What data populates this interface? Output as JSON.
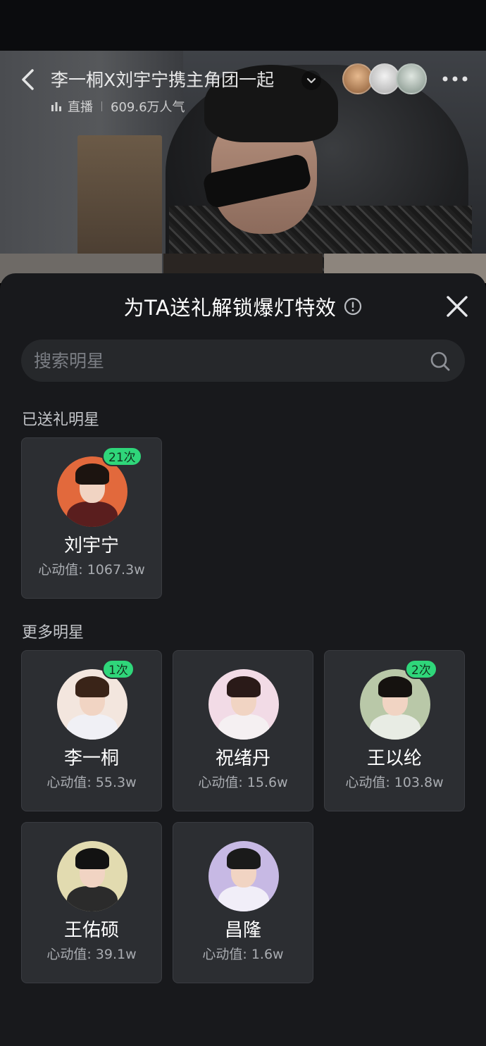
{
  "live": {
    "title": "李一桐X刘宇宁携主角团一起",
    "status": "直播",
    "popularity": "609.6万人气"
  },
  "sheet": {
    "title": "为TA送礼解锁爆灯特效",
    "search_placeholder": "搜索明星",
    "gifted_section_label": "已送礼明星",
    "more_section_label": "更多明星"
  },
  "gifted_stars": [
    {
      "name": "刘宇宁",
      "score": "心动值: 1067.3w",
      "badge": "21次",
      "avatar_bg": "#e2693c",
      "avatar_body": "#5a1e1e",
      "hair": "#1c1410"
    }
  ],
  "more_stars": [
    {
      "name": "李一桐",
      "score": "心动值: 55.3w",
      "badge": "1次",
      "avatar_bg": "#f3e6de",
      "avatar_body": "#f0f0f5",
      "hair": "#3a2418"
    },
    {
      "name": "祝绪丹",
      "score": "心动值: 15.6w",
      "badge": "",
      "avatar_bg": "#f2dbe6",
      "avatar_body": "#f5f0f2",
      "hair": "#2a1a18"
    },
    {
      "name": "王以纶",
      "score": "心动值: 103.8w",
      "badge": "2次",
      "avatar_bg": "#b9c8a8",
      "avatar_body": "#e8ece4",
      "hair": "#15120f"
    },
    {
      "name": "王佑硕",
      "score": "心动值: 39.1w",
      "badge": "",
      "avatar_bg": "#e2dbb0",
      "avatar_body": "#2b2b2b",
      "hair": "#121212"
    },
    {
      "name": "昌隆",
      "score": "心动值: 1.6w",
      "badge": "",
      "avatar_bg": "#c7b9e4",
      "avatar_body": "#f1eef8",
      "hair": "#1a1a1a"
    }
  ],
  "colors": {
    "sheet_bg": "#18191c",
    "card_bg": "#2c2e32",
    "badge_green": "#2fd67a"
  },
  "icons": [
    "back-icon",
    "chevron-down-icon",
    "more-icon",
    "info-icon",
    "close-icon",
    "search-icon"
  ]
}
